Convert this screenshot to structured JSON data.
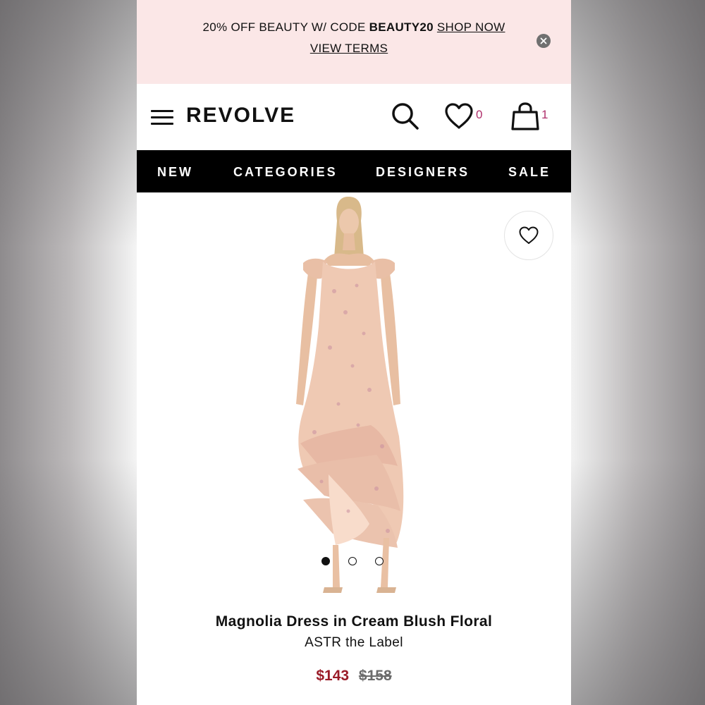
{
  "promo": {
    "text_prefix": "20% OFF BEAUTY W/ CODE ",
    "code": "BEAUTY20",
    "shop_now": "SHOP NOW",
    "view_terms": "VIEW TERMS"
  },
  "header": {
    "logo": "REVOLVE",
    "wishlist_count": "0",
    "bag_count": "1"
  },
  "nav": {
    "items": [
      "NEW",
      "CATEGORIES",
      "DESIGNERS",
      "SALE"
    ]
  },
  "product": {
    "name": "Magnolia Dress in Cream Blush Floral",
    "brand": "ASTR the Label",
    "price_sale": "$143",
    "price_original": "$158",
    "image_count": 3,
    "active_image_index": 0
  },
  "colors": {
    "promo_bg": "#fbe7e7",
    "nav_bg": "#000000",
    "count_accent": "#b0306c",
    "sale_price": "#9a1b27"
  },
  "icons": [
    "hamburger-icon",
    "search-icon",
    "heart-icon",
    "bag-icon",
    "close-icon"
  ]
}
